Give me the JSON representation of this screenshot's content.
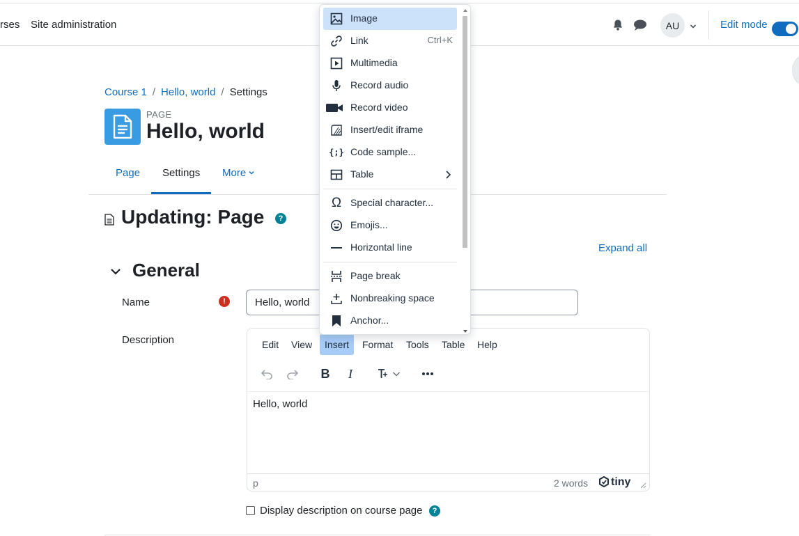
{
  "topnav": {
    "courses_partial": "rses",
    "site_admin": "Site administration",
    "avatar_initials": "AU",
    "edit_mode": "Edit mode"
  },
  "breadcrumb": [
    "Course 1",
    "Hello, world",
    "Settings"
  ],
  "page": {
    "kicker": "PAGE",
    "title": "Hello, world"
  },
  "tabs": [
    {
      "label": "Page",
      "active": false
    },
    {
      "label": "Settings",
      "active": true
    },
    {
      "label": "More",
      "active": false
    }
  ],
  "heading": "Updating: Page",
  "expand_all": "Expand all",
  "section": "General",
  "form": {
    "name_label": "Name",
    "name_value": "Hello, world",
    "desc_label": "Description",
    "display_desc_label": "Display description on course page"
  },
  "editor": {
    "menubar": [
      "Edit",
      "View",
      "Insert",
      "Format",
      "Tools",
      "Table",
      "Help"
    ],
    "open_menu": "Insert",
    "content": "Hello, world",
    "status_path": "p",
    "word_count": "2 words",
    "brand": "tiny"
  },
  "insert_menu": {
    "items": [
      {
        "label": "Image",
        "icon": "image-icon",
        "highlighted": true
      },
      {
        "label": "Link",
        "icon": "link-icon",
        "shortcut": "Ctrl+K"
      },
      {
        "label": "Multimedia",
        "icon": "multimedia-icon"
      },
      {
        "label": "Record audio",
        "icon": "microphone-icon"
      },
      {
        "label": "Record video",
        "icon": "video-camera-icon"
      },
      {
        "label": "Insert/edit iframe",
        "icon": "iframe-icon"
      },
      {
        "label": "Code sample...",
        "icon": "code-sample-icon"
      },
      {
        "label": "Table",
        "icon": "table-icon",
        "submenu": true
      },
      {
        "label": "Special character...",
        "icon": "omega-icon"
      },
      {
        "label": "Emojis...",
        "icon": "emoji-icon"
      },
      {
        "label": "Horizontal line",
        "icon": "horizontal-line-icon"
      },
      {
        "label": "Page break",
        "icon": "page-break-icon"
      },
      {
        "label": "Nonbreaking space",
        "icon": "nonbreaking-space-icon"
      },
      {
        "label": "Anchor...",
        "icon": "bookmark-icon"
      }
    ]
  },
  "colors": {
    "accent": "#0f6cbf",
    "menu_highlight": "#cce2fa",
    "help": "#008196",
    "required": "#ca3120",
    "page_icon": "#399be2"
  }
}
